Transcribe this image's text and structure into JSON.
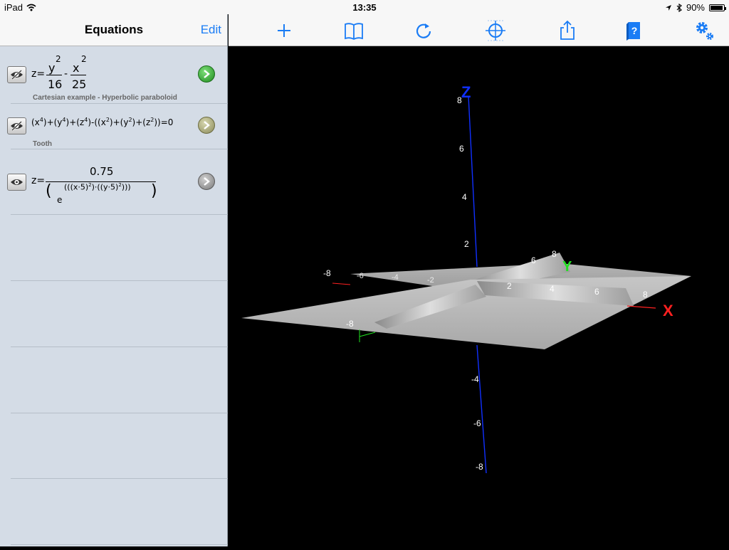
{
  "status": {
    "device": "iPad",
    "time": "13:35",
    "battery": "90%"
  },
  "sidebar": {
    "title": "Equations",
    "edit_label": "Edit",
    "equations": [
      {
        "lhs": "z=",
        "num1": "y",
        "exp1": "2",
        "den1": "16",
        "minus": "-",
        "num2": "x",
        "exp2": "2",
        "den2": "25",
        "caption": "Cartesian example - Hyperbolic paraboloid",
        "status": "green"
      },
      {
        "text": "(x",
        "caption": "Tooth",
        "status": "olive"
      },
      {
        "lhs": "z=",
        "numerator": "0.75",
        "base": "e",
        "status": "gray"
      }
    ]
  },
  "toolbar": {
    "icons": [
      "plus-icon",
      "book-icon",
      "rotate-icon",
      "crosshair-icon",
      "share-icon",
      "help-book-icon",
      "gear-icon"
    ],
    "accent": "#1a7cf5"
  },
  "graph": {
    "axis_labels": {
      "x": "X",
      "y": "Y",
      "z": "Z"
    },
    "axis_colors": {
      "x": "#ff2020",
      "y": "#20e020",
      "z": "#1030ff"
    },
    "z_ticks": [
      "8",
      "6",
      "4",
      "2",
      "-4",
      "-6",
      "-8"
    ],
    "x_ticks": [
      "2",
      "4",
      "6",
      "8"
    ],
    "x_neg_ticks": [
      "-8",
      "-6",
      "-4",
      "-2"
    ],
    "y_ticks": [
      "-8",
      "6",
      "8"
    ],
    "x_neg_end": "-8"
  }
}
